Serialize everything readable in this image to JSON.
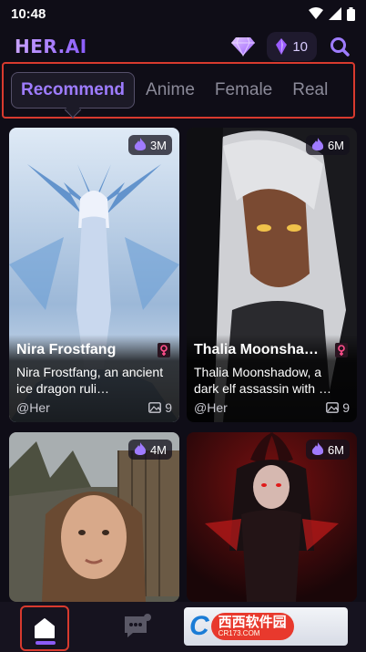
{
  "status_bar": {
    "time": "10:48"
  },
  "header": {
    "logo": "HER.AI",
    "credits": "10"
  },
  "tabs": [
    {
      "label": "Recommend",
      "active": true
    },
    {
      "label": "Anime",
      "active": false
    },
    {
      "label": "Female",
      "active": false
    },
    {
      "label": "Real",
      "active": false
    }
  ],
  "cards": [
    {
      "name": "Nira Frostfang",
      "description": "Nira Frostfang, an ancient ice dragon ruli…",
      "author": "@Her",
      "views": "3M",
      "images": "9"
    },
    {
      "name": "Thalia Moonsha…",
      "description": "Thalia Moonshadow, a dark elf assassin with …",
      "author": "@Her",
      "views": "6M",
      "images": "9"
    },
    {
      "name": "",
      "description": "",
      "author": "",
      "views": "4M",
      "images": ""
    },
    {
      "name": "",
      "description": "",
      "author": "",
      "views": "6M",
      "images": ""
    }
  ],
  "watermark": {
    "letter": "C",
    "text": "西西软件园",
    "sub": "CR173.COM"
  },
  "colors": {
    "accent": "#8b5cf6",
    "background": "#0f0d17",
    "highlight_border": "#d83a2e"
  }
}
